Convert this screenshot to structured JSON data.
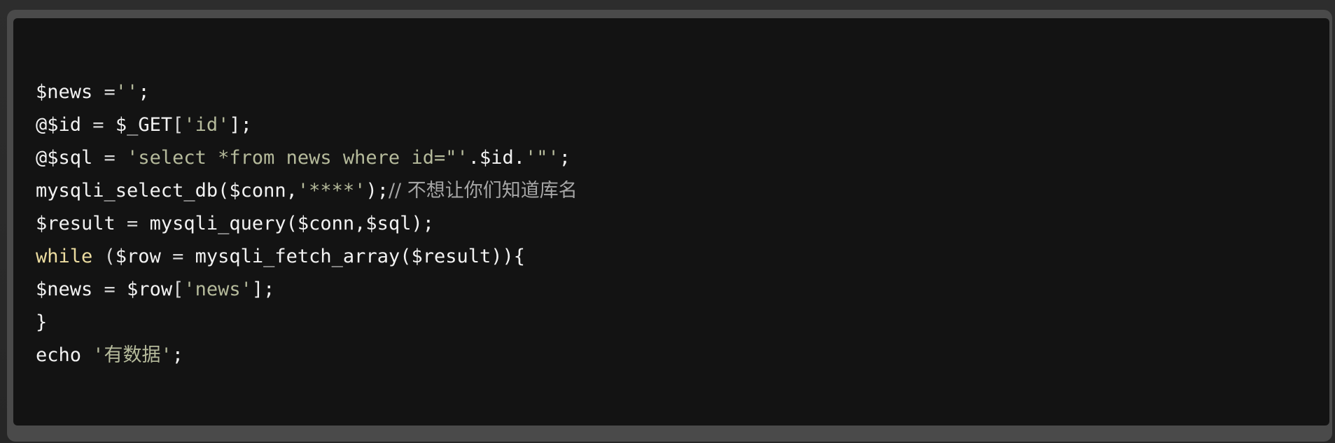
{
  "code": {
    "lines": [
      [
        {
          "t": "$news",
          "c": "def"
        },
        {
          "t": " =",
          "c": "op"
        },
        {
          "t": "''",
          "c": "str"
        },
        {
          "t": ";",
          "c": "def"
        }
      ],
      [
        {
          "t": "@$id",
          "c": "def"
        },
        {
          "t": " = ",
          "c": "op"
        },
        {
          "t": "$_GET",
          "c": "def"
        },
        {
          "t": "[",
          "c": "op"
        },
        {
          "t": "'id'",
          "c": "str"
        },
        {
          "t": "];",
          "c": "def"
        }
      ],
      [
        {
          "t": "@$sql",
          "c": "def"
        },
        {
          "t": " = ",
          "c": "op"
        },
        {
          "t": "'select *from news where id=\"'",
          "c": "str"
        },
        {
          "t": ".$id.",
          "c": "def"
        },
        {
          "t": "'\"'",
          "c": "str"
        },
        {
          "t": ";",
          "c": "def"
        }
      ],
      [
        {
          "t": "mysqli_select_db(",
          "c": "def"
        },
        {
          "t": "$conn",
          "c": "def"
        },
        {
          "t": ",",
          "c": "def"
        },
        {
          "t": "'****'",
          "c": "str"
        },
        {
          "t": ");",
          "c": "def"
        },
        {
          "t": "// 不想让你们知道库名",
          "c": "cmt"
        }
      ],
      [
        {
          "t": "$result",
          "c": "def"
        },
        {
          "t": " = ",
          "c": "op"
        },
        {
          "t": "mysqli_query($conn,$sql);",
          "c": "def"
        }
      ],
      [
        {
          "t": "while",
          "c": "kw"
        },
        {
          "t": " (",
          "c": "op"
        },
        {
          "t": "$row",
          "c": "def"
        },
        {
          "t": " = ",
          "c": "op"
        },
        {
          "t": "mysqli_fetch_array($result)){",
          "c": "def"
        }
      ],
      [
        {
          "t": "$news",
          "c": "def"
        },
        {
          "t": " = ",
          "c": "op"
        },
        {
          "t": "$row",
          "c": "def"
        },
        {
          "t": "[",
          "c": "op"
        },
        {
          "t": "'news'",
          "c": "str"
        },
        {
          "t": "];",
          "c": "def"
        }
      ],
      [
        {
          "t": "}",
          "c": "def"
        }
      ],
      [
        {
          "t": "echo ",
          "c": "def"
        },
        {
          "t": "'有数据'",
          "c": "str"
        },
        {
          "t": ";",
          "c": "def"
        }
      ]
    ]
  }
}
